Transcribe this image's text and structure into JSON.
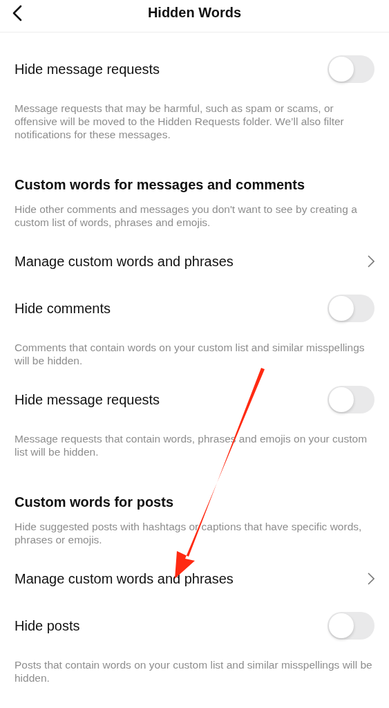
{
  "header": {
    "title": "Hidden Words"
  },
  "items": [
    {
      "kind": "toggle",
      "label": "Hide message requests",
      "on": false
    },
    {
      "kind": "description",
      "text": "Message requests that may be harmful, such as spam or scams, or offensive will be moved to the Hidden Requests folder. We’ll also filter notifications for these messages."
    },
    {
      "kind": "heading",
      "text": "Custom words for messages and comments"
    },
    {
      "kind": "description",
      "text": "Hide other comments and messages you don't want to see by creating a custom list of words, phrases and emojis."
    },
    {
      "kind": "link",
      "label": "Manage custom words and phrases"
    },
    {
      "kind": "toggle",
      "label": "Hide comments",
      "on": false
    },
    {
      "kind": "description",
      "text": "Comments that contain words on your custom list and similar misspellings will be hidden."
    },
    {
      "kind": "toggle",
      "label": "Hide message requests",
      "on": false
    },
    {
      "kind": "description",
      "text": "Message requests that contain words, phrases and emojis on your custom list will be hidden."
    },
    {
      "kind": "heading",
      "text": "Custom words for posts"
    },
    {
      "kind": "description",
      "text": "Hide suggested posts with hashtags or captions that have specific words, phrases or emojis."
    },
    {
      "kind": "link",
      "label": "Manage custom words and phrases"
    },
    {
      "kind": "toggle",
      "label": "Hide posts",
      "on": false
    },
    {
      "kind": "description",
      "text": "Posts that contain words on your custom list and similar misspellings will be hidden."
    }
  ]
}
